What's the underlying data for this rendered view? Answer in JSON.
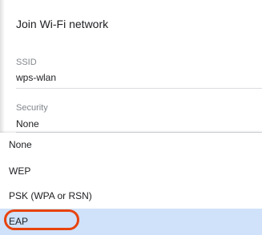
{
  "dialog": {
    "title": "Join Wi-Fi network"
  },
  "ssid": {
    "label": "SSID",
    "value": "wps-wlan"
  },
  "security": {
    "label": "Security",
    "value": "None"
  },
  "dropdown": {
    "options": [
      {
        "label": "None"
      },
      {
        "label": "WEP"
      },
      {
        "label": "PSK (WPA or RSN)"
      },
      {
        "label": "EAP"
      }
    ],
    "highlighted": "EAP"
  },
  "colors": {
    "highlight_bg": "#cfe2f9",
    "annotation_ring": "#e8430e"
  }
}
